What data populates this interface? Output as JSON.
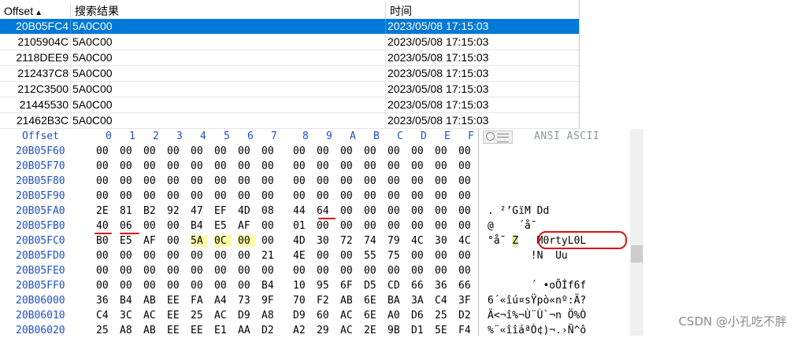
{
  "results": {
    "columns": [
      "Offset",
      "搜索结果",
      "时间"
    ],
    "sort_indicator": "▲",
    "rows": [
      {
        "offset": "20B05FC4",
        "result": "5A0C00",
        "time": "2023/05/08  17:15:03",
        "selected": true
      },
      {
        "offset": "2105904C",
        "result": "5A0C00",
        "time": "2023/05/08  17:15:03"
      },
      {
        "offset": "2118DEE9",
        "result": "5A0C00",
        "time": "2023/05/08  17:15:03"
      },
      {
        "offset": "212437C8",
        "result": "5A0C00",
        "time": "2023/05/08  17:15:03"
      },
      {
        "offset": "212C3500",
        "result": "5A0C00",
        "time": "2023/05/08  17:15:03"
      },
      {
        "offset": "21445530",
        "result": "5A0C00",
        "time": "2023/05/08  17:15:03"
      },
      {
        "offset": "21462B3C",
        "result": "5A0C00",
        "time": "2023/05/08  17:15:03"
      }
    ]
  },
  "hex": {
    "offset_header": "Offset",
    "col_headers": [
      "0",
      "1",
      "2",
      "3",
      "4",
      "5",
      "6",
      "7",
      "8",
      "9",
      "A",
      "B",
      "C",
      "D",
      "E",
      "F"
    ],
    "ansi_header": "ANSI ASCII",
    "rows": [
      {
        "offset": "20B05F60",
        "bytes": [
          "00",
          "00",
          "00",
          "00",
          "00",
          "00",
          "00",
          "00",
          "00",
          "00",
          "00",
          "00",
          "00",
          "00",
          "00",
          "00"
        ],
        "ascii": ""
      },
      {
        "offset": "20B05F70",
        "bytes": [
          "00",
          "00",
          "00",
          "00",
          "00",
          "00",
          "00",
          "00",
          "00",
          "00",
          "00",
          "00",
          "00",
          "00",
          "00",
          "00"
        ],
        "ascii": ""
      },
      {
        "offset": "20B05F80",
        "bytes": [
          "00",
          "00",
          "00",
          "00",
          "00",
          "00",
          "00",
          "00",
          "00",
          "00",
          "00",
          "00",
          "00",
          "00",
          "00",
          "00"
        ],
        "ascii": ""
      },
      {
        "offset": "20B05F90",
        "bytes": [
          "00",
          "00",
          "00",
          "00",
          "00",
          "00",
          "00",
          "00",
          "00",
          "00",
          "00",
          "00",
          "00",
          "00",
          "00",
          "00"
        ],
        "ascii": ""
      },
      {
        "offset": "20B05FA0",
        "bytes": [
          "2E",
          "81",
          "B2",
          "92",
          "47",
          "EF",
          "4D",
          "08",
          "44",
          "64",
          "00",
          "00",
          "00",
          "00",
          "00",
          "00"
        ],
        "ascii": ". ²’GïM Dd"
      },
      {
        "offset": "20B05FB0",
        "bytes": [
          "40",
          "06",
          "00",
          "00",
          "B4",
          "E5",
          "AF",
          "00",
          "01",
          "00",
          "00",
          "00",
          "00",
          "00",
          "00",
          "00"
        ],
        "ascii": "@    ´å¯"
      },
      {
        "offset": "20B05FC0",
        "bytes": [
          "B0",
          "E5",
          "AF",
          "00",
          "5A",
          "0C",
          "00",
          "00",
          "4D",
          "30",
          "72",
          "74",
          "79",
          "4C",
          "30",
          "4C"
        ],
        "ascii_pre": "°å¯ ",
        "ascii_hl": "Z",
        "ascii_post": "   M0rtyL0L"
      },
      {
        "offset": "20B05FD0",
        "bytes": [
          "00",
          "00",
          "00",
          "00",
          "00",
          "00",
          "00",
          "21",
          "4E",
          "00",
          "00",
          "55",
          "75",
          "00",
          "00",
          "00"
        ],
        "ascii": "       !N  Uu"
      },
      {
        "offset": "20B05FE0",
        "bytes": [
          "00",
          "00",
          "00",
          "00",
          "00",
          "00",
          "00",
          "00",
          "00",
          "00",
          "00",
          "00",
          "00",
          "00",
          "00",
          "00"
        ],
        "ascii": ""
      },
      {
        "offset": "20B05FF0",
        "bytes": [
          "00",
          "00",
          "00",
          "00",
          "00",
          "00",
          "00",
          "B4",
          "10",
          "95",
          "6F",
          "D5",
          "CD",
          "66",
          "36",
          "66"
        ],
        "ascii": "       ´ •oÕÍf6f"
      },
      {
        "offset": "20B06000",
        "bytes": [
          "36",
          "B4",
          "AB",
          "EE",
          "FA",
          "A4",
          "73",
          "9F",
          "70",
          "F2",
          "AB",
          "6E",
          "BA",
          "3A",
          "C4",
          "3F"
        ],
        "ascii": "6´«îú¤sŸpò«nº:Ä?"
      },
      {
        "offset": "20B06010",
        "bytes": [
          "C4",
          "3C",
          "AC",
          "EE",
          "25",
          "AC",
          "D9",
          "A8",
          "D9",
          "60",
          "AC",
          "6E",
          "A0",
          "D6",
          "25",
          "D2"
        ],
        "ascii": "Ä<¬î%¬Ù¨Ù`¬n Ö%Ò"
      },
      {
        "offset": "20B06020",
        "bytes": [
          "25",
          "A8",
          "AB",
          "EE",
          "EE",
          "E1",
          "AA",
          "D2",
          "A2",
          "29",
          "AC",
          "2E",
          "9B",
          "D1",
          "5E",
          "F4"
        ],
        "ascii": "%¨«îîáªÒ¢)¬.›Ñ^ô"
      }
    ]
  },
  "watermark": "CSDN @小孔吃不胖"
}
